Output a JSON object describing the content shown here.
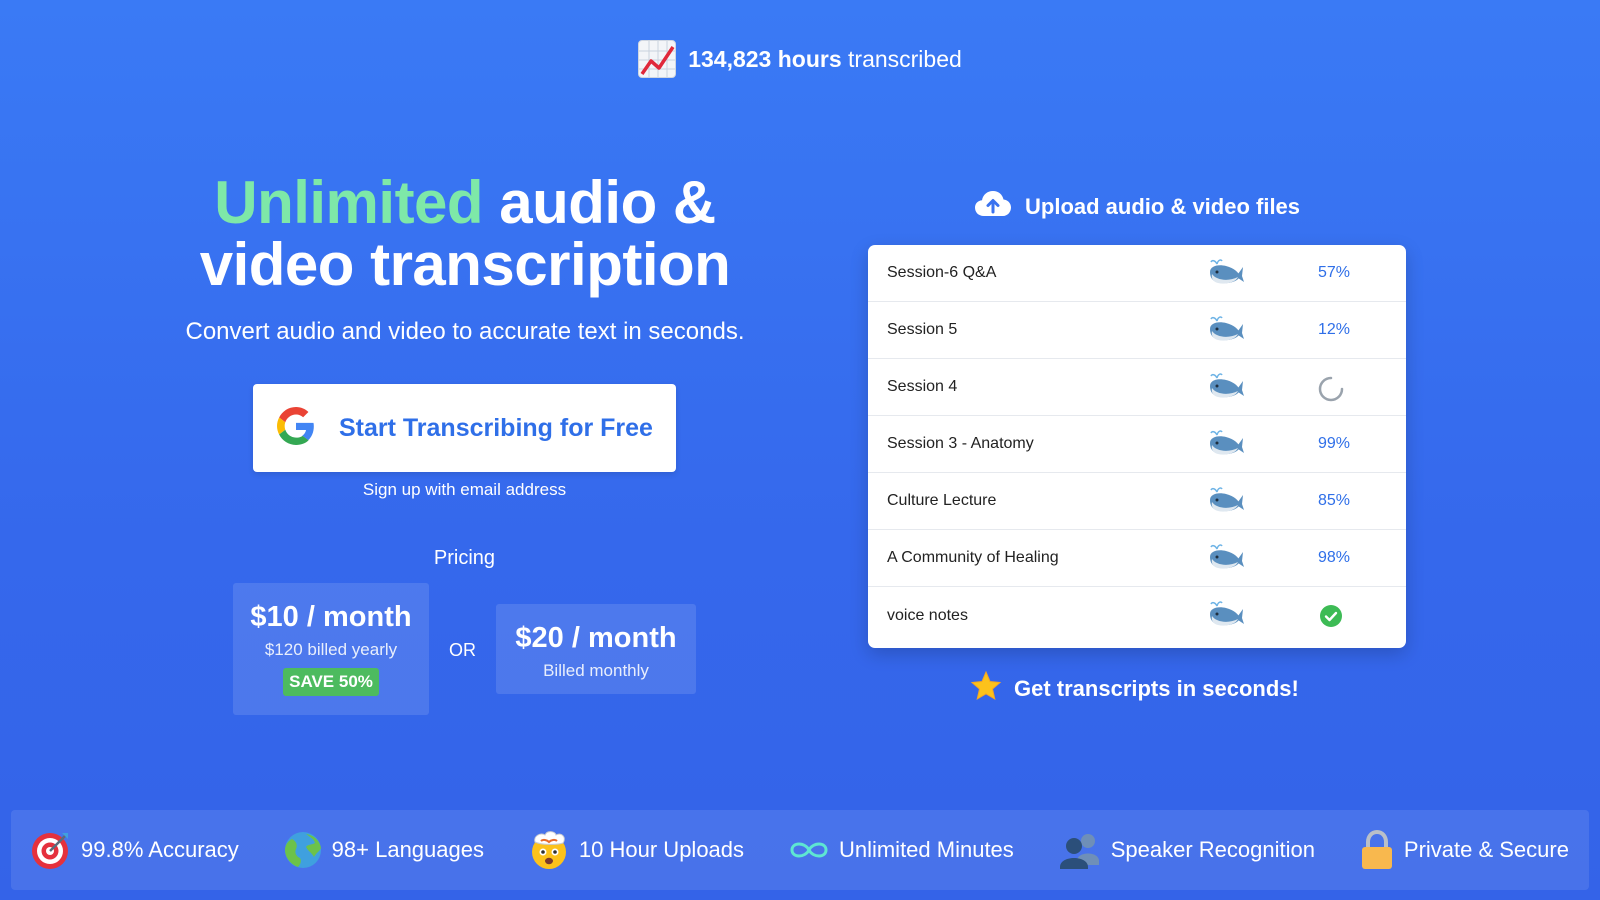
{
  "stats": {
    "hours": "134,823 hours",
    "suffix": "transcribed"
  },
  "hero": {
    "title_accent": "Unlimited",
    "title_rest_line1": "audio &",
    "title_line2": "video transcription",
    "subtitle": "Convert audio and video to accurate text in seconds."
  },
  "cta": {
    "label": "Start Transcribing for Free",
    "email_link": "Sign up with email address"
  },
  "pricing": {
    "title": "Pricing",
    "or": "OR",
    "yearly": {
      "amount": "$10 / month",
      "note": "$120 billed yearly",
      "badge": "SAVE 50%"
    },
    "monthly": {
      "amount": "$20 / month",
      "note": "Billed monthly"
    }
  },
  "upload": {
    "title": "Upload audio & video files",
    "files": [
      {
        "name": "Session-6 Q&A",
        "status": "57%"
      },
      {
        "name": "Session 5",
        "status": "12%"
      },
      {
        "name": "Session 4",
        "status": ""
      },
      {
        "name": "Session 3 - Anatomy",
        "status": "99%"
      },
      {
        "name": "Culture Lecture",
        "status": "85%"
      },
      {
        "name": "A Community of Healing",
        "status": "98%"
      },
      {
        "name": "voice notes",
        "status": ""
      }
    ],
    "footer": "Get transcripts in seconds!"
  },
  "features": [
    {
      "label": "99.8% Accuracy",
      "icon": "target-icon"
    },
    {
      "label": "98+ Languages",
      "icon": "globe-icon"
    },
    {
      "label": "10 Hour Uploads",
      "icon": "mind-blown-icon"
    },
    {
      "label": "Unlimited Minutes",
      "icon": "infinity-icon"
    },
    {
      "label": "Speaker Recognition",
      "icon": "people-icon"
    },
    {
      "label": "Private & Secure",
      "icon": "lock-icon"
    }
  ],
  "colors": {
    "accent_green": "#7ee8a8",
    "link_blue": "#2f6fe8",
    "badge_green": "#4dbb5f"
  }
}
